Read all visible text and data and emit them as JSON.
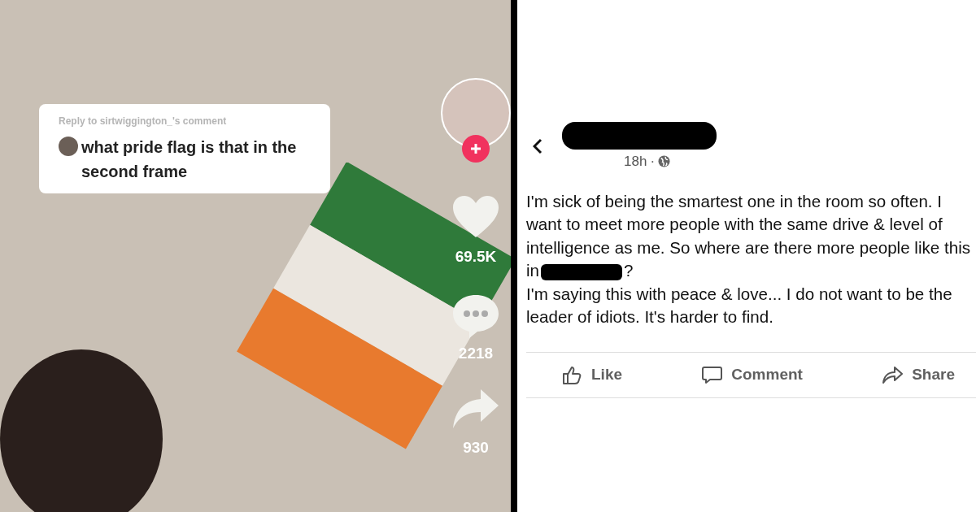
{
  "video_post": {
    "reply_label": "Reply to sirtwiggington_'s comment",
    "comment": "what pride flag is that in the second frame",
    "likes": "69.5K",
    "comments": "2218",
    "shares": "930"
  },
  "feed_post": {
    "time": "18h",
    "separator": "·",
    "text_before_redaction": "I'm sick of being the smartest one in the room so often. I want to meet more people with the same drive & level of intelligence as me. So where are there more people like this in",
    "text_after_redaction": "?",
    "text_second": "I'm saying this with peace & love... I do not want to be the leader of idiots. It's harder to find.",
    "actions": [
      {
        "kind": "like",
        "label": "Like"
      },
      {
        "kind": "comment",
        "label": "Comment"
      },
      {
        "kind": "share",
        "label": "Share"
      }
    ]
  }
}
